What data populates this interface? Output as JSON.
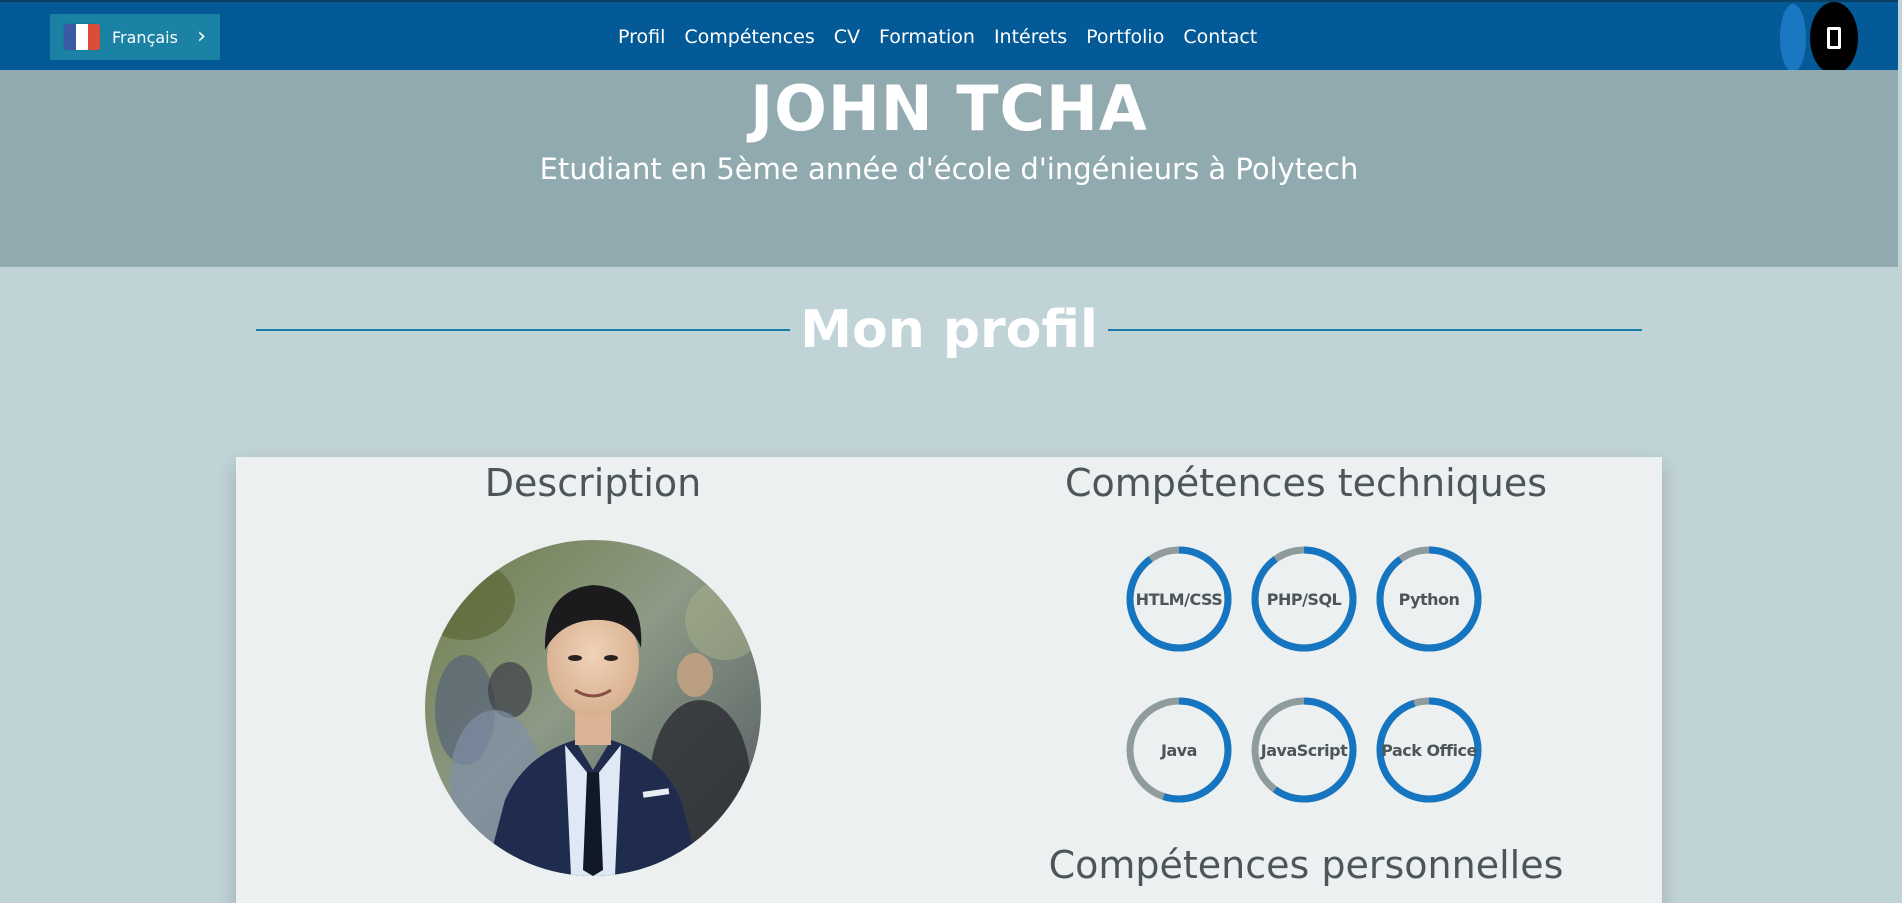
{
  "navbar": {
    "language": "Français",
    "links": [
      "Profil",
      "Compétences",
      "CV",
      "Formation",
      "Intérets",
      "Portfolio",
      "Contact"
    ]
  },
  "hero": {
    "name": "JOHN TCHA",
    "subtitle": "Etudiant en 5ème année d'école d'ingénieurs à Polytech"
  },
  "profile": {
    "section_title": "Mon profil",
    "description_title": "Description",
    "tech_skills_title": "Compétences techniques",
    "personal_skills_title": "Compétences personnelles",
    "tech_skills": [
      {
        "label": "HTLM/CSS",
        "level": 0.9
      },
      {
        "label": "PHP/SQL",
        "level": 0.9
      },
      {
        "label": "Python",
        "level": 0.9
      },
      {
        "label": "Java",
        "level": 0.55
      },
      {
        "label": "JavaScript",
        "level": 0.6
      },
      {
        "label": "Pack Office",
        "level": 0.95
      }
    ]
  },
  "colors": {
    "navbar": "#035a96",
    "hero": "#90aaaf",
    "page": "#c0d3d7",
    "card": "#ecf0f0",
    "ring_fill": "#1575c1",
    "ring_track": "#8f9b9c"
  },
  "icons": {
    "flag": "france-flag-icon",
    "chevron": "chevron-right-icon",
    "mobile": "mobile-phone-icon"
  }
}
